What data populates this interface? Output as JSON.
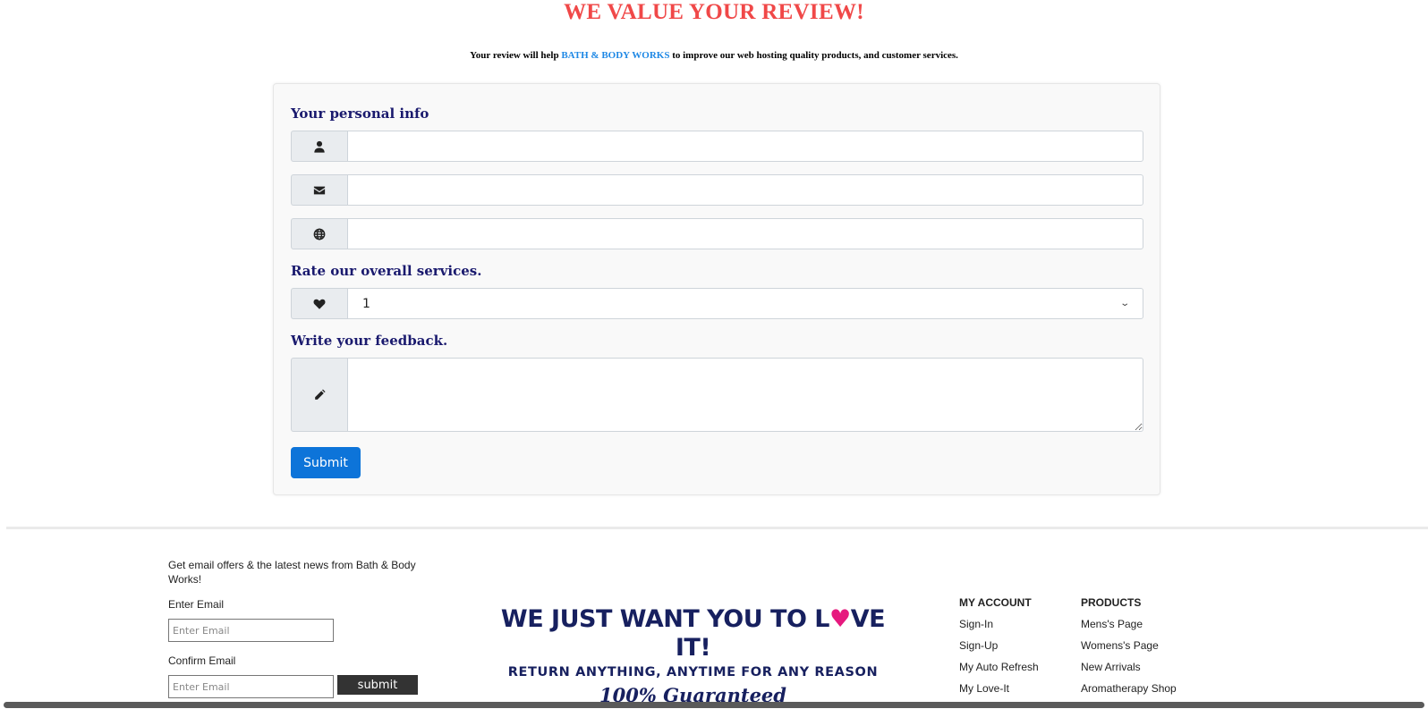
{
  "header": {
    "title": "WE VALUE YOUR REVIEW!",
    "subtitle_before": "Your review will help",
    "subtitle_brand": "BATH & BODY WORKS",
    "subtitle_after": "to improve our web hosting quality products, and customer services."
  },
  "form": {
    "personal_info_label": "Your personal info",
    "name_value": "",
    "email_value": "",
    "website_value": "",
    "rating_label": "Rate our overall services.",
    "rating_value": "1",
    "feedback_label": "Write your feedback.",
    "feedback_value": "",
    "submit_label": "Submit"
  },
  "footer": {
    "newsletter_text": "Get email offers & the latest news from Bath & Body Works!",
    "enter_email_label": "Enter Email",
    "enter_email_placeholder": "Enter Email",
    "confirm_email_label": "Confirm Email",
    "confirm_email_placeholder": "Enter Email",
    "newsletter_submit": "submit",
    "promo": {
      "line1_a": "WE JUST WANT YOU TO L",
      "line1_heart": "♥",
      "line1_b": "VE IT!",
      "line2": "RETURN ANYTHING, ANYTIME FOR ANY REASON",
      "line3": "100% Guaranteed"
    },
    "account": {
      "heading": "MY ACCOUNT",
      "links": [
        "Sign-In",
        "Sign-Up",
        "My Auto Refresh",
        "My Love-It"
      ]
    },
    "products": {
      "heading": "PRODUCTS",
      "links": [
        "Mens's Page",
        "Womens's Page",
        "New Arrivals",
        "Aromatherapy Shop"
      ]
    }
  },
  "icons": {
    "name": "user-icon",
    "email": "envelope-icon",
    "website": "globe-icon",
    "rating": "heart-icon",
    "feedback": "pencil-icon"
  },
  "colors": {
    "title": "#f04848",
    "brand_link": "#1e88e5",
    "label": "#1a1a6e",
    "submit_bg": "#0d74d9",
    "promo_navy": "#17205f",
    "promo_heart": "#e6197e"
  }
}
